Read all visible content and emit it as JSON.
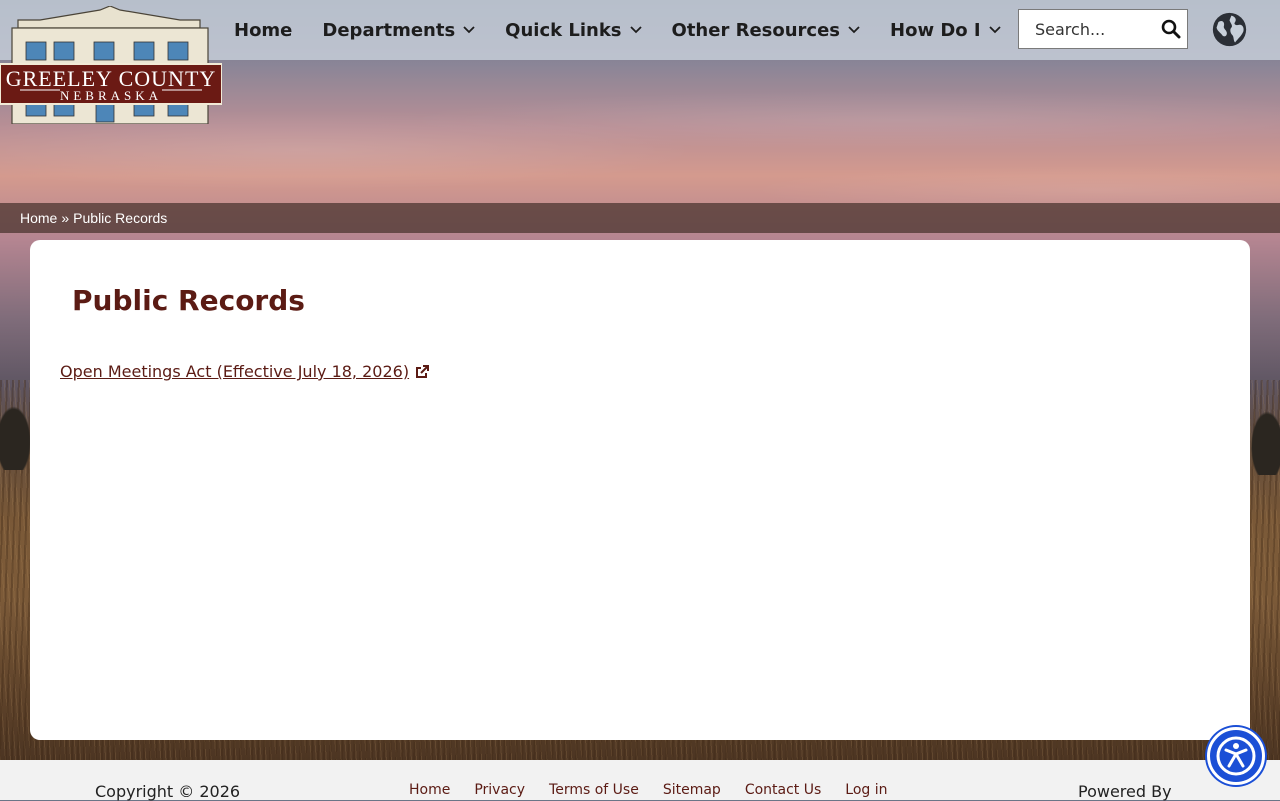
{
  "logo": {
    "line1": "GREELEY COUNTY",
    "line2": "NEBRASKA"
  },
  "nav": {
    "items": [
      {
        "label": "Home",
        "has_dropdown": false
      },
      {
        "label": "Departments",
        "has_dropdown": true
      },
      {
        "label": "Quick Links",
        "has_dropdown": true
      },
      {
        "label": "Other Resources",
        "has_dropdown": true
      },
      {
        "label": "How Do I",
        "has_dropdown": true
      }
    ]
  },
  "search": {
    "placeholder": "Search...",
    "icon": "magnifier-icon"
  },
  "language": {
    "icon": "globe-icon"
  },
  "breadcrumb": {
    "home": "Home",
    "separator": "»",
    "current": "Public Records"
  },
  "main": {
    "title": "Public Records",
    "link_text": "Open Meetings Act (Effective July 18, 2026)",
    "link_icon": "external-link-icon"
  },
  "footer": {
    "copyright": "Copyright © 2026",
    "links": [
      "Home",
      "Privacy",
      "Terms of Use",
      "Sitemap",
      "Contact Us",
      "Log in"
    ],
    "powered_by": "Powered By"
  },
  "accessibility": {
    "icon": "accessibility-icon",
    "color": "#1b4fd6"
  },
  "colors": {
    "accent": "#5b1b14"
  }
}
